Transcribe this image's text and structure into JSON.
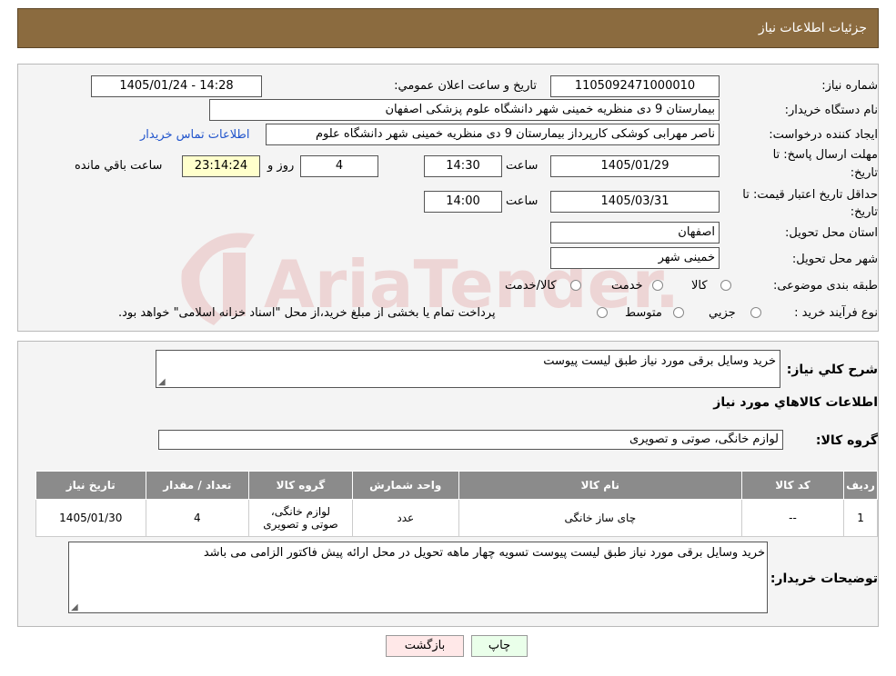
{
  "header": {
    "title": "جزئیات اطلاعات نیاز"
  },
  "form": {
    "need_number_label": "شماره نیاز:",
    "need_number": "1105092471000010",
    "announce_label": "تاریخ و ساعت اعلان عمومي:",
    "announce_value": "1405/01/24 - 14:28",
    "buyer_label": "نام دستگاه خریدار:",
    "buyer_value": "بیمارستان 9 دی منظریه خمینی شهر دانشگاه علوم پزشکی اصفهان",
    "requester_label": "ایجاد کننده درخواست:",
    "requester_value": "ناصر مهرابی کوشکی کارپرداز بیمارستان 9 دی منظریه خمینی شهر دانشگاه علوم",
    "contact_link": "اطلاعات تماس خریدار",
    "deadline_label_1": "مهلت ارسال پاسخ: تا",
    "deadline_label_2": "تاریخ:",
    "deadline_date": "1405/01/29",
    "time_label": "ساعت",
    "deadline_time": "14:30",
    "days_value": "4",
    "days_label": "روز و",
    "remaining_value": "23:14:24",
    "remaining_label": "ساعت باقي مانده",
    "validity_label_1": "حداقل تاریخ اعتبار قیمت: تا",
    "validity_label_2": "تاریخ:",
    "validity_date": "1405/03/31",
    "validity_time": "14:00",
    "province_label": "استان محل تحویل:",
    "province_value": "اصفهان",
    "city_label": "شهر محل تحویل:",
    "city_value": "خمینی شهر",
    "category_label": "طبقه بندی موضوعی:",
    "category_options": [
      "کالا",
      "خدمت",
      "کالا/خدمت"
    ],
    "process_label": "نوع فرآیند خرید :",
    "process_options": [
      "جزیي",
      "متوسط"
    ],
    "process_note": "پرداخت تمام یا بخشی از مبلغ خرید،از محل \"اسناد خزانه اسلامی\" خواهد بود."
  },
  "summary": {
    "desc_label": "شرح کلي نیاز:",
    "desc_value": "خرید وسایل برقی مورد نیاز طبق لیست پیوست",
    "goods_info_title": "اطلاعات کالاهاي مورد نیاز",
    "group_label": "گروه کالا:",
    "group_value": "لوازم خانگی، صوتی و تصویری"
  },
  "table": {
    "headers": [
      "ردیف",
      "کد کالا",
      "نام کالا",
      "واحد شمارش",
      "گروه کالا",
      "تعداد / مقدار",
      "تاریخ نیاز"
    ],
    "row": {
      "index": "1",
      "code": "--",
      "name": "چای ساز خانگی",
      "unit": "عدد",
      "group_line1": "لوازم خانگی،",
      "group_line2": "صوتی و تصویری",
      "qty": "4",
      "date": "1405/01/30"
    }
  },
  "buyer_notes": {
    "label": "توضیحات خریدار:",
    "value": "خرید وسایل برقی مورد نیاز طبق لیست پیوست تسویه چهار ماهه تحویل در محل ارائه پیش فاکتور الزامی می باشد"
  },
  "buttons": {
    "print": "چاپ",
    "back": "بازگشت"
  },
  "watermark": {
    "text": "AriaTender.neT"
  },
  "colors": {
    "header_bg": "#8b6b3f",
    "table_header_bg": "#8b8b8b",
    "link": "#2255cc"
  }
}
